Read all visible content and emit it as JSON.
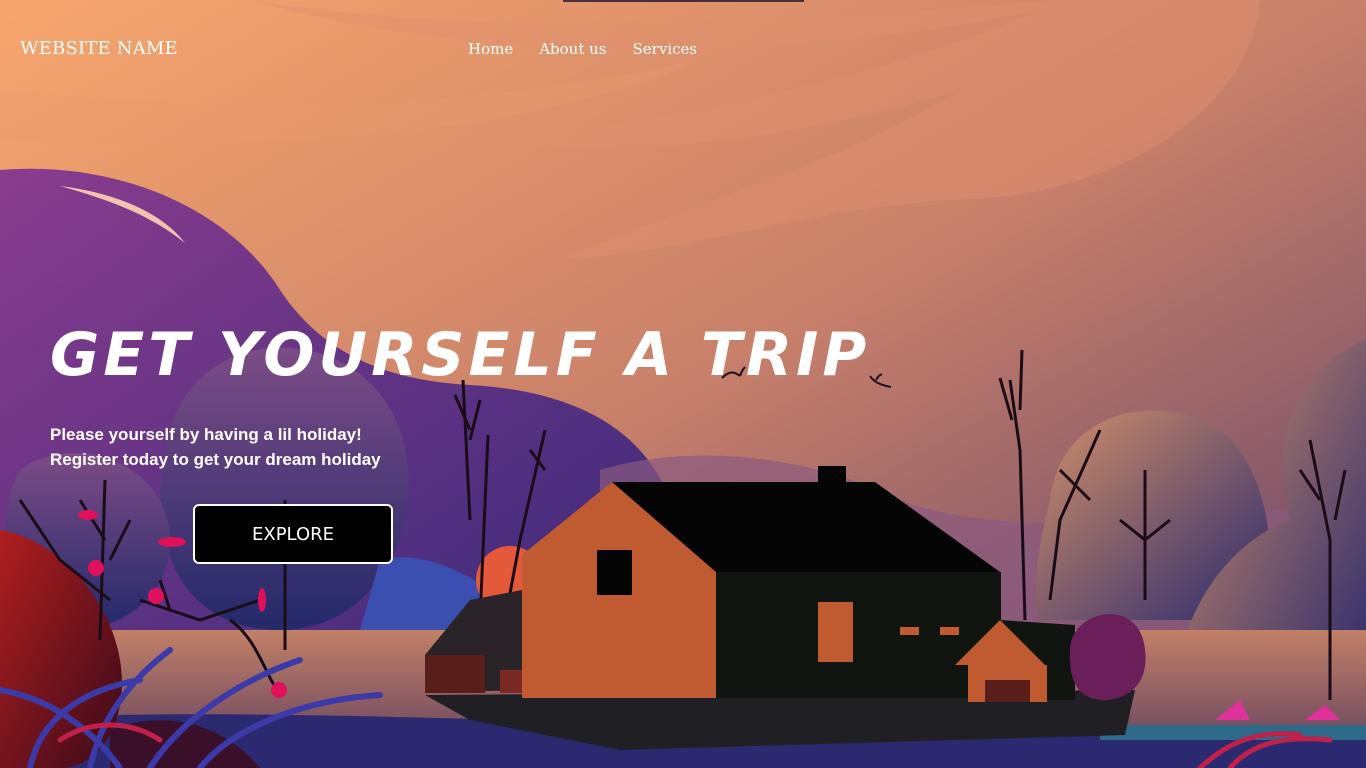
{
  "header": {
    "brand": "WEBSITE NAME",
    "nav": [
      {
        "label": "Home"
      },
      {
        "label": "About us"
      },
      {
        "label": "Services"
      }
    ]
  },
  "hero": {
    "title": "GET YOURSELF A TRIP",
    "lines": [
      "Please yourself by having a lil holiday!",
      "Register today to get your dream holiday"
    ],
    "button_label": "EXPLORE"
  },
  "colors": {
    "sky_top": "#f4a36d",
    "sky_bottom": "#7a4a6a",
    "house_orange": "#c05a30",
    "house_dark": "#101510",
    "button_bg": "#000000"
  }
}
